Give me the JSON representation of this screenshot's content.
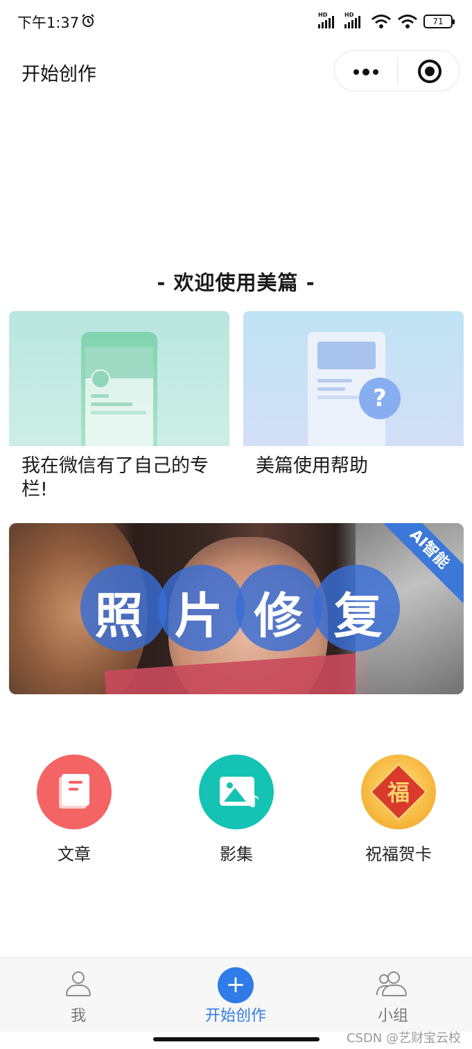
{
  "status_bar": {
    "time": "下午1:37",
    "battery": "71",
    "network_label": "HD"
  },
  "nav": {
    "title": "开始创作"
  },
  "welcome": "- 欢迎使用美篇 -",
  "cards": [
    {
      "title": "我在微信有了自己的专栏!"
    },
    {
      "title": "美篇使用帮助"
    }
  ],
  "banner": {
    "title": [
      "照",
      "片",
      "修",
      "复"
    ],
    "badge": "AI智能"
  },
  "actions": [
    {
      "label": "文章",
      "icon": "article-icon",
      "color": "#f56464"
    },
    {
      "label": "影集",
      "icon": "photo-album-icon",
      "color": "#14c3b4"
    },
    {
      "label": "祝福贺卡",
      "icon": "greeting-card-icon",
      "color": "#f5b338",
      "emblem": "福"
    }
  ],
  "tabbar": {
    "items": [
      {
        "label": "我",
        "icon": "user-icon"
      },
      {
        "label": "开始创作",
        "icon": "plus-icon",
        "active": true
      },
      {
        "label": "小组",
        "icon": "group-icon"
      }
    ],
    "accent": "#2f7be8"
  },
  "watermark": "CSDN @艺财宝云校"
}
